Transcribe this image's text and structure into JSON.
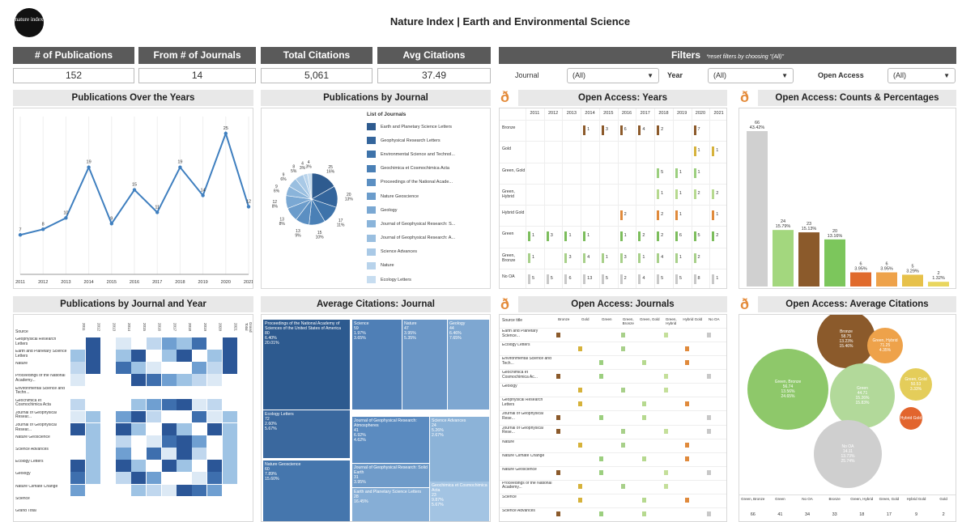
{
  "header": {
    "logo_text": "nature index",
    "title": "Nature Index | Earth and Environmental Science"
  },
  "kpis": [
    {
      "label": "# of Publications",
      "value": "152"
    },
    {
      "label": "From # of Journals",
      "value": "14"
    },
    {
      "label": "Total Citations",
      "value": "5,061"
    },
    {
      "label": "Avg Citations",
      "value": "37.49"
    }
  ],
  "filters": {
    "title": "Filters",
    "note": "*reset filters by choosing \"(All)\"",
    "journal_label": "Journal",
    "journal_value": "(All)",
    "year_label": "Year",
    "year_value": "(All)",
    "oa_label": "Open Access",
    "oa_value": "(All)"
  },
  "sections": {
    "pubs_years": "Publications Over the Years",
    "pubs_journal": "Publications by Journal",
    "oa_years": "Open Access: Years",
    "oa_counts": "Open Access: Counts & Percentages",
    "pubs_journal_year": "Publications by Journal and Year",
    "avg_cit_journal": "Average Citations: Journal",
    "oa_journals": "Open Access: Journals",
    "oa_avg_cit": "Open Access: Average Citations"
  },
  "chart_data": [
    {
      "type": "line",
      "title": "Publications Over the Years",
      "x": [
        "2011",
        "2012",
        "2013",
        "2014",
        "2015",
        "2016",
        "2017",
        "2018",
        "2019",
        "2020",
        "2021"
      ],
      "values": [
        7,
        8,
        10,
        19,
        9,
        15,
        11,
        19,
        14,
        25,
        12
      ],
      "ylim": [
        0,
        28
      ],
      "color": "#3f7fbf"
    },
    {
      "type": "pie",
      "title": "Publications by Journal",
      "legend_title": "List of Journals",
      "categories": [
        "Earth and Planetary Science Letters",
        "Geophysical Research Letters",
        "Environmental Science and Technol...",
        "Geochimica et Cosmochimica Acta",
        "Proceedings of the National Acade...",
        "Nature Geoscience",
        "Geology",
        "Journal of Geophysical Research: S...",
        "Journal of Geophysical Research: A...",
        "Science Advances",
        "Nature",
        "Ecology Letters"
      ],
      "values": [
        25,
        20,
        17,
        15,
        13,
        13,
        12,
        9,
        9,
        8,
        4,
        4
      ],
      "pct_labels": [
        "16%",
        "13%",
        "11%",
        "10%",
        "9%",
        "8%",
        "8%",
        "6%",
        "6%",
        "5%",
        "3%",
        "3%"
      ],
      "colors": [
        "#2e5b8f",
        "#34659c",
        "#3e73aa",
        "#4a80b6",
        "#5b8fc2",
        "#6b9ccb",
        "#7aa8d3",
        "#8ab4da",
        "#9abfe0",
        "#a9c9e6",
        "#b8d3eb",
        "#c7ddf0"
      ]
    },
    {
      "type": "table",
      "title": "Open Access: Years",
      "years": [
        "2011",
        "2012",
        "2013",
        "2014",
        "2015",
        "2016",
        "2017",
        "2018",
        "2019",
        "2020",
        "2021"
      ],
      "rows": [
        {
          "label": "Bronze",
          "cells": [
            "",
            "",
            "",
            "1",
            "3",
            "6",
            "4",
            "2",
            "",
            "7",
            ""
          ],
          "color": "#8c5a2b"
        },
        {
          "label": "Gold",
          "cells": [
            "",
            "",
            "",
            "",
            "",
            "",
            "",
            "",
            "",
            "1",
            "1"
          ],
          "color": "#d6b23b"
        },
        {
          "label": "Green, Gold",
          "cells": [
            "",
            "",
            "",
            "",
            "",
            "",
            "",
            "5",
            "1",
            "1",
            ""
          ],
          "color": "#9ccf7f"
        },
        {
          "label": "Green, Hybrid",
          "cells": [
            "",
            "",
            "",
            "",
            "",
            "",
            "",
            "1",
            "1",
            "2",
            "2"
          ],
          "color": "#b6d98f"
        },
        {
          "label": "Hybrid Gold",
          "cells": [
            "",
            "",
            "",
            "",
            "",
            "2",
            "",
            "2",
            "1",
            "",
            "1"
          ],
          "color": "#e08a3c"
        },
        {
          "label": "Green",
          "cells": [
            "1",
            "3",
            "1",
            "1",
            "",
            "1",
            "2",
            "2",
            "6",
            "5",
            "2"
          ],
          "color": "#7cbd5c"
        },
        {
          "label": "Green, Bronze",
          "cells": [
            "1",
            "",
            "3",
            "4",
            "1",
            "3",
            "1",
            "4",
            "1",
            "2",
            ""
          ],
          "color": "#a8d08a"
        },
        {
          "label": "No OA",
          "cells": [
            "5",
            "5",
            "6",
            "13",
            "5",
            "2",
            "4",
            "5",
            "5",
            "8",
            "1"
          ],
          "color": "#c8c8c8"
        }
      ]
    },
    {
      "type": "bar",
      "title": "Open Access: Counts & Percentages",
      "categories": [
        "Green, Bronze",
        "Green",
        "No OA",
        "Bronze",
        "Green, Hybrid",
        "Green, Gold",
        "Hybrid Gold",
        "Gold"
      ],
      "values": [
        66,
        24,
        23,
        20,
        6,
        6,
        5,
        2
      ],
      "pct_labels": [
        "43.42%",
        "15.79%",
        "15.13%",
        "13.16%",
        "3.95%",
        "3.95%",
        "3.29%",
        "1.32%"
      ],
      "colors": [
        "#d0d0d0",
        "#a3d77e",
        "#8b5a2b",
        "#7cc65c",
        "#e06a2c",
        "#eea24a",
        "#e7c14a",
        "#e9d65f"
      ],
      "table_values": [
        "66",
        "41",
        "34",
        "33",
        "18",
        "17",
        "9",
        "2"
      ]
    },
    {
      "type": "heatmap",
      "title": "Publications by Journal and Year",
      "col_header": "Source",
      "years": [
        "2011",
        "2012",
        "2013",
        "2014",
        "2015",
        "2016",
        "2017",
        "2018",
        "2019",
        "2020",
        "2021",
        "Grand Total"
      ],
      "rows": [
        "Geophysical Research Letters",
        "Earth and Planetary Science Letters",
        "Nature",
        "Proceedings of the National Academy...",
        "Environmental Science and Techn...",
        "Geochimica et Cosmochimica Acta",
        "Journal of Geophysical Resear...",
        "Journal of Geophysical Resear...",
        "Nature Geoscience",
        "Science Advances",
        "Ecology Letters",
        "Geology",
        "Nature Climate Change",
        "Science",
        "Grand Total"
      ]
    },
    {
      "type": "treemap",
      "title": "Average Citations: Journal",
      "items": [
        {
          "name": "Proceedings of the National Academy of Sciences of the United States of America",
          "value": "80",
          "pct": "6.40%",
          "pct2": "20.01%"
        },
        {
          "name": "Science",
          "value": "59",
          "pct": "1.97%",
          "pct2": "3.65%"
        },
        {
          "name": "Nature",
          "value": "47",
          "pct": "3.95%",
          "pct2": "5.35%"
        },
        {
          "name": "Geology",
          "value": "44",
          "pct": "6.46%",
          "pct2": "7.65%"
        },
        {
          "name": "Ecology Letters",
          "value": "72",
          "pct": "2.60%",
          "pct2": "5.67%"
        },
        {
          "name": "Journal of Geophysical Research: Atmospheres",
          "value": "41",
          "pct": "6.92%",
          "pct2": "4.62%"
        },
        {
          "name": "Science Advances",
          "value": "24",
          "pct": "5.26%",
          "pct2": "2.67%"
        },
        {
          "name": "Nature Geoscience",
          "value": "60",
          "pct": "7.89%",
          "pct2": "15.60%"
        },
        {
          "name": "Journal of Geophysical Research: Solid Earth",
          "value": "31",
          "pct": "3.95%",
          "pct2": ""
        },
        {
          "name": "Earth and Planetary Science Letters",
          "value": "28",
          "pct": "16.45%",
          "pct2": ""
        },
        {
          "name": "Geochimica et Cosmochimica Acta",
          "value": "23",
          "pct": "9.87%",
          "pct2": "5.67%"
        }
      ]
    },
    {
      "type": "table",
      "title": "Open Access: Journals",
      "col_header": "Source title",
      "columns": [
        "Bronze",
        "Gold",
        "Green",
        "Green, Bronze",
        "Green, Gold",
        "Green, Hybrid",
        "Hybrid Gold",
        "No OA"
      ],
      "rows": [
        "Earth and Planetary Science...",
        "Ecology Letters",
        "Environmental Science and Tech...",
        "Geochimica et Cosmochimica Ac...",
        "Geology",
        "Geophysical Research Letters",
        "Journal of Geophysical Rese...",
        "Journal of Geophysical Rese...",
        "Nature",
        "Nature Climate Change",
        "Nature Geoscience",
        "Proceedings of the National Academy...",
        "Science",
        "Science Advances"
      ]
    },
    {
      "type": "scatter",
      "title": "Open Access: Average Citations",
      "bubbles": [
        {
          "name": "Bronze",
          "l1": "58.75",
          "l2": "13.23%",
          "l3": "15.46%",
          "color": "#8b5a2b"
        },
        {
          "name": "Green, Hybrid",
          "l1": "71.25",
          "l2": "4.35%",
          "l3": "",
          "color": "#eea24a"
        },
        {
          "name": "Green, Bronze",
          "l1": "56.74",
          "l2": "13.56%",
          "l3": "24.65%",
          "color": "#8ec86a"
        },
        {
          "name": "Green",
          "l1": "44.71",
          "l2": "15.26%",
          "l3": "15.83%",
          "color": "#b2d99a"
        },
        {
          "name": "Green, Gold",
          "l1": "50.53",
          "l2": "3.33%",
          "l3": "",
          "color": "#e4cd5a"
        },
        {
          "name": "Hybrid Gold",
          "l1": "",
          "l2": "",
          "l3": "",
          "color": "#e2652e"
        },
        {
          "name": "No OA",
          "l1": "14.11",
          "l2": "13.73%",
          "l3": "25.74%",
          "color": "#cfcfcf"
        }
      ],
      "table_labels": [
        "Green, Bronze",
        "Green",
        "No OA",
        "Bronze",
        "Green, Hybrid",
        "Green, Gold",
        "Hybrid Gold",
        "Gold"
      ],
      "table_values": [
        "66",
        "41",
        "34",
        "33",
        "18",
        "17",
        "9",
        "2"
      ]
    }
  ]
}
